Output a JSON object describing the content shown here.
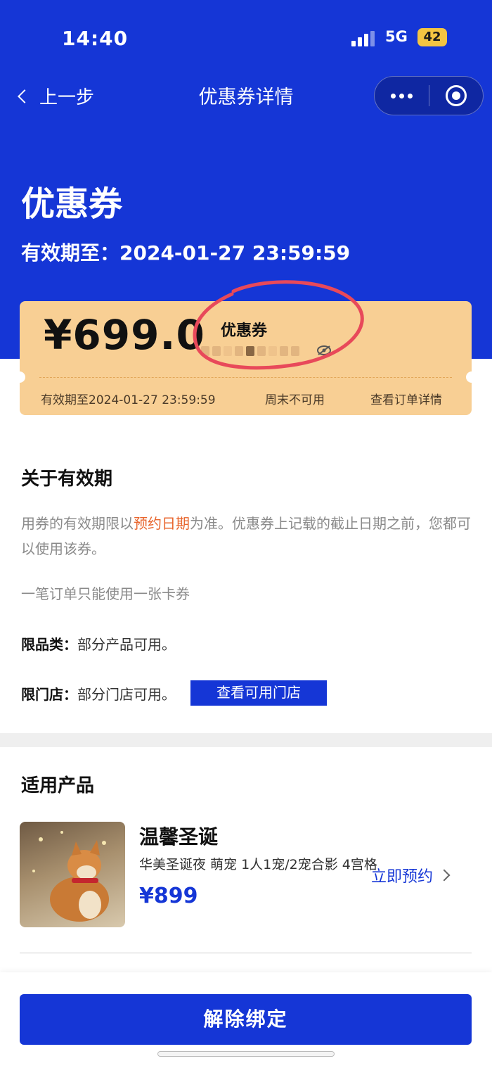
{
  "status_bar": {
    "time": "14:40",
    "network": "5G",
    "battery": "42"
  },
  "nav": {
    "back_label": "上一步",
    "title": "优惠券详情"
  },
  "header": {
    "title": "优惠券",
    "expiry": "有效期至：2024-01-27 23:59:59"
  },
  "coupon": {
    "amount": "¥699.0",
    "name": "优惠券",
    "expiry": "有效期至2024-01-27 23:59:59",
    "restriction": "周末不可用",
    "order_link": "查看订单详情"
  },
  "validity": {
    "title": "关于有效期",
    "para_before": "用券的有效期限以",
    "para_highlight": "预约日期",
    "para_after": "为准。优惠券上记载的截止日期之前，您都可以使用该券。",
    "note": "一笔订单只能使用一张卡券",
    "category_label": "限品类：",
    "category_value": "部分产品可用。",
    "store_label": "限门店：",
    "store_value": "部分门店可用。",
    "store_button": "查看可用门店"
  },
  "products": {
    "title": "适用产品",
    "items": [
      {
        "name": "温馨圣诞",
        "desc": "华美圣诞夜 萌宠 1人1宠/2宠合影 4宫格",
        "price": "¥899",
        "action": "立即预约"
      }
    ]
  },
  "footer": {
    "unbind_button": "解除绑定"
  },
  "colors": {
    "primary": "#1536d6",
    "coupon_bg": "#f8cf94",
    "highlight": "#e8652d"
  }
}
